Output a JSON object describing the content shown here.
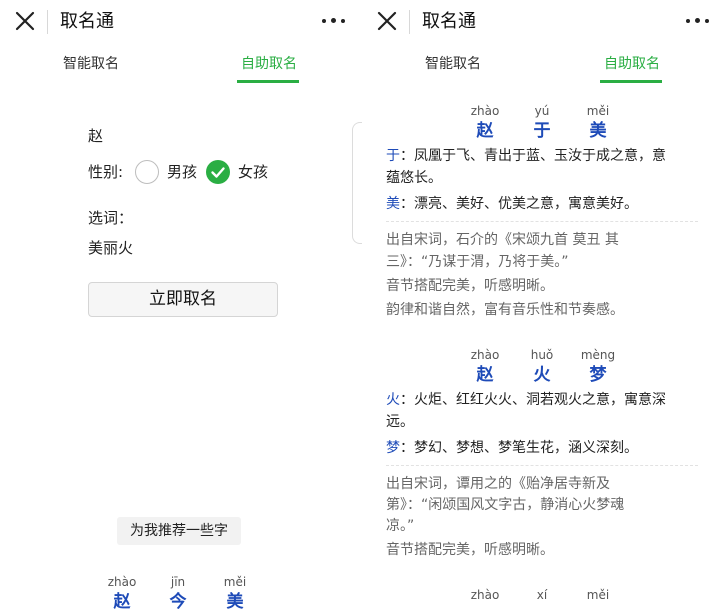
{
  "app": {
    "title": "取名通"
  },
  "tabs": [
    {
      "label": "智能取名",
      "active": false
    },
    {
      "label": "自助取名",
      "active": true
    }
  ],
  "form": {
    "surname": "赵",
    "gender_label": "性别:",
    "gender_options": [
      {
        "label": "男孩",
        "selected": false
      },
      {
        "label": "女孩",
        "selected": true
      }
    ],
    "words_label": "选词：",
    "words_value": "美丽火",
    "submit_label": "立即取名",
    "recommend_label": "为我推荐一些字",
    "preview_name": [
      {
        "pinyin": "zhào",
        "char": "赵"
      },
      {
        "pinyin": "jīn",
        "char": "今"
      },
      {
        "pinyin": "měi",
        "char": "美"
      }
    ]
  },
  "results": [
    {
      "name": [
        {
          "pinyin": "zhào",
          "char": "赵"
        },
        {
          "pinyin": "yú",
          "char": "于"
        },
        {
          "pinyin": "měi",
          "char": "美"
        }
      ],
      "meanings": [
        {
          "char": "于",
          "line1": "：凤凰于飞、青出于蓝、玉汝于成之意，意",
          "line2": "蕴悠长。"
        },
        {
          "char": "美",
          "line1": "：漂亮、美好、优美之意，寓意美好。",
          "line2": ""
        }
      ],
      "notes": [
        "出自宋词，石介的《宋颂九首 莫丑 其",
        "三》：“乃谋于渭，乃将于美。”",
        "音节搭配完美，听感明晰。",
        "韵律和谐自然，富有音乐性和节奏感。"
      ]
    },
    {
      "name": [
        {
          "pinyin": "zhào",
          "char": "赵"
        },
        {
          "pinyin": "huǒ",
          "char": "火"
        },
        {
          "pinyin": "mèng",
          "char": "梦"
        }
      ],
      "meanings": [
        {
          "char": "火",
          "line1": "：火炬、红红火火、洞若观火之意，寓意深",
          "line2": "远。"
        },
        {
          "char": "梦",
          "line1": "：梦幻、梦想、梦笔生花，涵义深刻。",
          "line2": ""
        }
      ],
      "notes": [
        "出自宋词，谭用之的《贻净居寺新及",
        "第》：“闲颂国风文字古，静消心火梦魂",
        "凉。”",
        "音节搭配完美，听感明晰。"
      ]
    },
    {
      "name": [
        {
          "pinyin": "zhào",
          "char": "赵"
        },
        {
          "pinyin": "xí",
          "char": ""
        },
        {
          "pinyin": "měi",
          "char": ""
        }
      ]
    }
  ]
}
